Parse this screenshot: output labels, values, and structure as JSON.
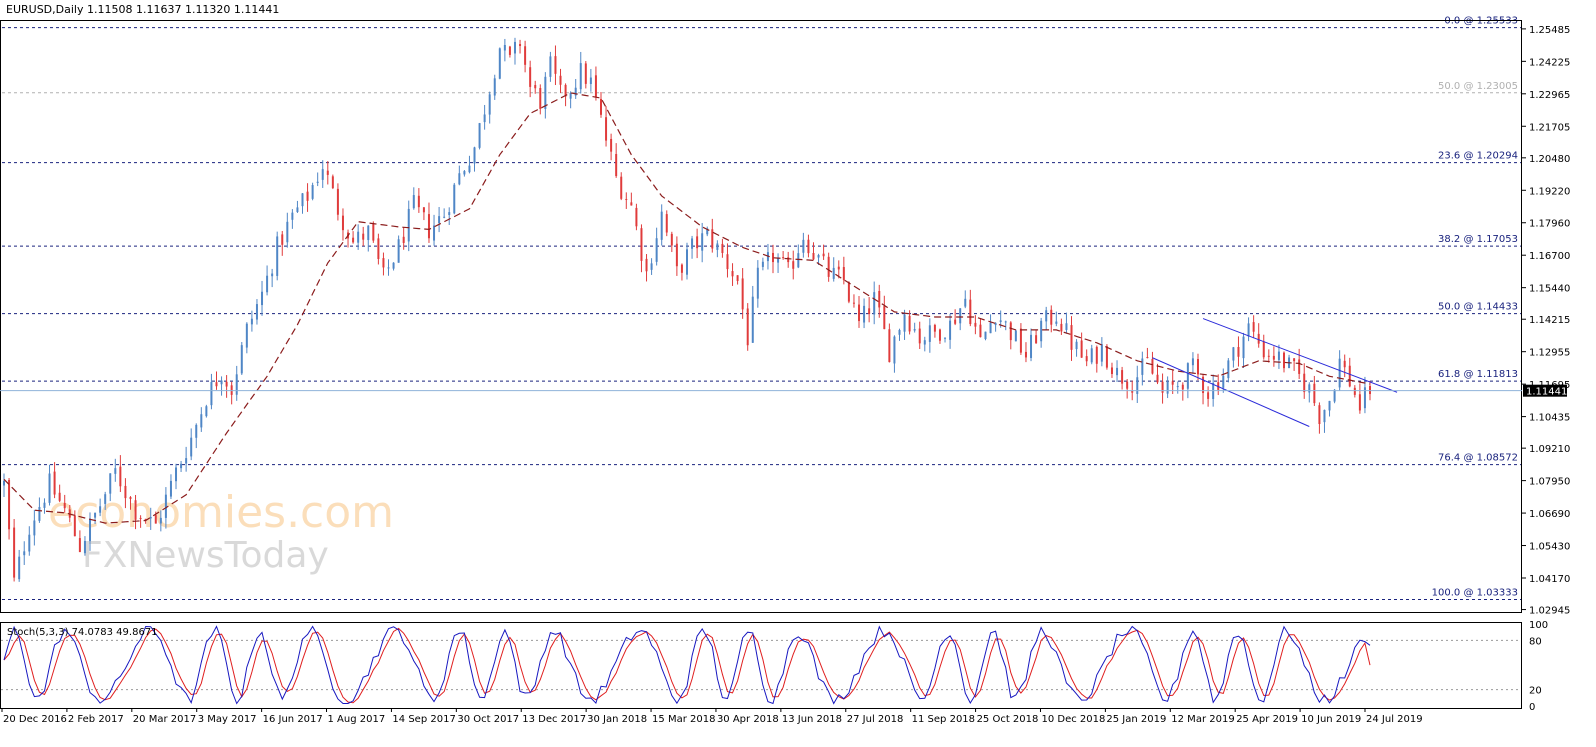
{
  "chart_data": {
    "type": "candlestick",
    "symbol_header": "EURUSD,Daily  1.11508 1.11637 1.11320 1.11441",
    "current_price": "1.11441",
    "ylim": [
      1.0285,
      1.2583
    ],
    "price_ticks": [
      "1.25485",
      "1.24225",
      "1.22965",
      "1.21705",
      "1.20480",
      "1.19220",
      "1.17960",
      "1.16700",
      "1.15440",
      "1.14215",
      "1.12955",
      "1.11695",
      "1.10435",
      "1.09210",
      "1.07950",
      "1.06690",
      "1.05430",
      "1.04170",
      "1.02945"
    ],
    "date_ticks": [
      "20 Dec 2016",
      "2 Feb 2017",
      "20 Mar 2017",
      "3 May 2017",
      "16 Jun 2017",
      "1 Aug 2017",
      "14 Sep 2017",
      "30 Oct 2017",
      "13 Dec 2017",
      "30 Jan 2018",
      "15 Mar 2018",
      "30 Apr 2018",
      "13 Jun 2018",
      "27 Jul 2018",
      "11 Sep 2018",
      "25 Oct 2018",
      "10 Dec 2018",
      "25 Jan 2019",
      "12 Mar 2019",
      "25 Apr 2019",
      "10 Jun 2019",
      "24 Jul 2019"
    ],
    "fibonacci_levels": [
      {
        "label": "0.0 @ 1.25533",
        "value": 1.25533,
        "style": "main"
      },
      {
        "label": "50.0 @ 1.23005",
        "value": 1.23005,
        "style": "faint"
      },
      {
        "label": "23.6 @ 1.20294",
        "value": 1.20294,
        "style": "main"
      },
      {
        "label": "38.2 @ 1.17053",
        "value": 1.17053,
        "style": "main"
      },
      {
        "label": "50.0 @ 1.14433",
        "value": 1.14433,
        "style": "main"
      },
      {
        "label": "61.8 @ 1.11813",
        "value": 1.11813,
        "style": "main"
      },
      {
        "label": "76.4 @ 1.08572",
        "value": 1.08572,
        "style": "main"
      },
      {
        "label": "100.0 @ 1.03333",
        "value": 1.03333,
        "style": "main"
      }
    ],
    "price_path_keypoints": [
      [
        0,
        1.078
      ],
      [
        2,
        1.04
      ],
      [
        5,
        1.062
      ],
      [
        9,
        1.078
      ],
      [
        12,
        1.068
      ],
      [
        15,
        1.054
      ],
      [
        19,
        1.07
      ],
      [
        22,
        1.083
      ],
      [
        26,
        1.068
      ],
      [
        30,
        1.062
      ],
      [
        34,
        1.083
      ],
      [
        37,
        1.096
      ],
      [
        40,
        1.112
      ],
      [
        43,
        1.122
      ],
      [
        45,
        1.115
      ],
      [
        48,
        1.138
      ],
      [
        51,
        1.152
      ],
      [
        54,
        1.17
      ],
      [
        57,
        1.182
      ],
      [
        60,
        1.19
      ],
      [
        63,
        1.202
      ],
      [
        66,
        1.185
      ],
      [
        69,
        1.172
      ],
      [
        72,
        1.176
      ],
      [
        75,
        1.158
      ],
      [
        78,
        1.17
      ],
      [
        81,
        1.186
      ],
      [
        84,
        1.177
      ],
      [
        87,
        1.183
      ],
      [
        90,
        1.198
      ],
      [
        93,
        1.209
      ],
      [
        96,
        1.232
      ],
      [
        98,
        1.248
      ],
      [
        100,
        1.242
      ],
      [
        102,
        1.25
      ],
      [
        104,
        1.232
      ],
      [
        106,
        1.227
      ],
      [
        108,
        1.24
      ],
      [
        110,
        1.229
      ],
      [
        112,
        1.232
      ],
      [
        114,
        1.238
      ],
      [
        116,
        1.234
      ],
      [
        119,
        1.212
      ],
      [
        121,
        1.197
      ],
      [
        124,
        1.186
      ],
      [
        127,
        1.16
      ],
      [
        130,
        1.183
      ],
      [
        133,
        1.16
      ],
      [
        136,
        1.17
      ],
      [
        139,
        1.175
      ],
      [
        142,
        1.167
      ],
      [
        145,
        1.157
      ],
      [
        147,
        1.135
      ],
      [
        149,
        1.158
      ],
      [
        152,
        1.167
      ],
      [
        155,
        1.16
      ],
      [
        158,
        1.175
      ],
      [
        160,
        1.168
      ],
      [
        163,
        1.16
      ],
      [
        166,
        1.157
      ],
      [
        169,
        1.14
      ],
      [
        172,
        1.15
      ],
      [
        175,
        1.13
      ],
      [
        178,
        1.145
      ],
      [
        181,
        1.135
      ],
      [
        184,
        1.137
      ],
      [
        187,
        1.14
      ],
      [
        190,
        1.15
      ],
      [
        193,
        1.133
      ],
      [
        196,
        1.145
      ],
      [
        199,
        1.137
      ],
      [
        202,
        1.128
      ],
      [
        205,
        1.14
      ],
      [
        208,
        1.144
      ],
      [
        211,
        1.133
      ],
      [
        214,
        1.125
      ],
      [
        217,
        1.131
      ],
      [
        220,
        1.121
      ],
      [
        223,
        1.118
      ],
      [
        226,
        1.125
      ],
      [
        229,
        1.113
      ],
      [
        232,
        1.117
      ],
      [
        235,
        1.123
      ],
      [
        238,
        1.114
      ],
      [
        241,
        1.121
      ],
      [
        244,
        1.132
      ],
      [
        246,
        1.139
      ],
      [
        249,
        1.13
      ],
      [
        252,
        1.127
      ],
      [
        255,
        1.122
      ],
      [
        258,
        1.115
      ],
      [
        260,
        1.105
      ],
      [
        262,
        1.111
      ],
      [
        264,
        1.126
      ],
      [
        266,
        1.118
      ],
      [
        268,
        1.108
      ],
      [
        270,
        1.115
      ]
    ],
    "moving_average_keypoints": [
      [
        0,
        1.08
      ],
      [
        6,
        1.068
      ],
      [
        12,
        1.067
      ],
      [
        20,
        1.063
      ],
      [
        28,
        1.064
      ],
      [
        36,
        1.074
      ],
      [
        44,
        1.098
      ],
      [
        52,
        1.12
      ],
      [
        58,
        1.14
      ],
      [
        64,
        1.164
      ],
      [
        70,
        1.18
      ],
      [
        78,
        1.178
      ],
      [
        84,
        1.177
      ],
      [
        92,
        1.185
      ],
      [
        98,
        1.206
      ],
      [
        104,
        1.222
      ],
      [
        112,
        1.23
      ],
      [
        118,
        1.228
      ],
      [
        124,
        1.206
      ],
      [
        130,
        1.19
      ],
      [
        138,
        1.178
      ],
      [
        146,
        1.17
      ],
      [
        152,
        1.166
      ],
      [
        160,
        1.165
      ],
      [
        168,
        1.155
      ],
      [
        176,
        1.145
      ],
      [
        184,
        1.143
      ],
      [
        192,
        1.143
      ],
      [
        200,
        1.138
      ],
      [
        208,
        1.138
      ],
      [
        216,
        1.133
      ],
      [
        224,
        1.126
      ],
      [
        232,
        1.122
      ],
      [
        240,
        1.12
      ],
      [
        248,
        1.126
      ],
      [
        256,
        1.125
      ],
      [
        262,
        1.12
      ],
      [
        270,
        1.117
      ]
    ],
    "trend_channel": {
      "upper": [
        [
          1.1424
        ],
        [
          1.1138
        ]
      ],
      "lower": [
        [
          1.1347
        ],
        [
          1.1005
        ]
      ]
    },
    "stochastic": {
      "label": "Stoch(5,3,3) 74.0783 49.8671",
      "axis_ticks": [
        "100",
        "80",
        "20",
        "0"
      ],
      "levels": [
        80,
        20
      ],
      "k_value": 74.0783,
      "d_value": 49.8671
    },
    "colors": {
      "bull": "#4f86c6",
      "bear": "#e03b3b",
      "ma": "#8b1c1c",
      "fib": "#1a237e",
      "faint_fib": "#b0b0b0",
      "channel": "#2b2bd9",
      "stoch_main": "#1818c0",
      "stoch_signal": "#e02020"
    }
  },
  "watermark": {
    "brand_top": "economies.com",
    "brand_bottom": "FXNewsToday"
  }
}
